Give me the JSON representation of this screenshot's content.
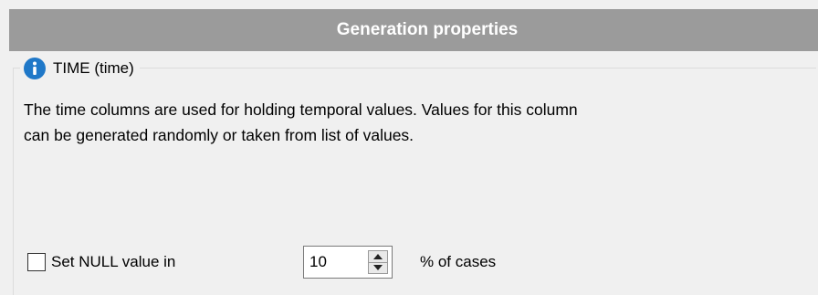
{
  "header": {
    "title": "Generation properties"
  },
  "group": {
    "icon": "info-icon",
    "title": "TIME (time)",
    "accent_color": "#1f78c8"
  },
  "description": {
    "line1": "The time columns are used for holding temporal values. Values for this column",
    "line2": "can be generated randomly or taken from list of values."
  },
  "null_setting": {
    "checkbox_checked": false,
    "label": "Set NULL value in",
    "value": "10",
    "suffix": "% of cases",
    "spin_up_icon": "triangle-up-icon",
    "spin_down_icon": "triangle-down-icon"
  }
}
